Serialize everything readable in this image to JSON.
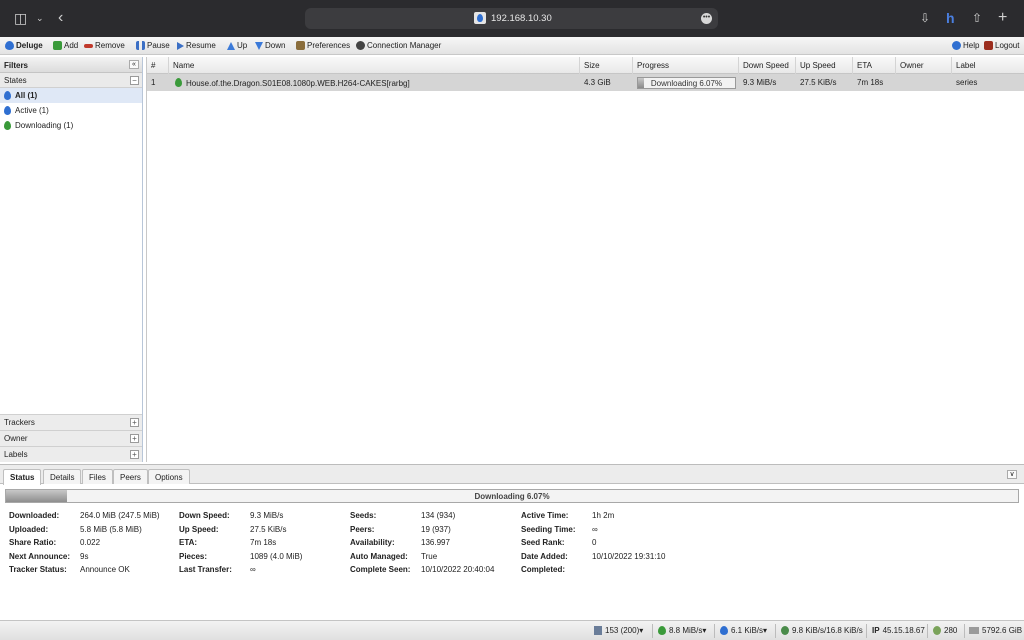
{
  "browser": {
    "address": "192.168.10.30",
    "icons": [
      "sidebar-icon",
      "chevron-down-icon",
      "back-icon",
      "more-icon",
      "download-icon",
      "extension-icon",
      "share-icon",
      "new-tab-icon"
    ]
  },
  "toolbar": {
    "app_name": "Deluge",
    "add": "Add",
    "remove": "Remove",
    "pause": "Pause",
    "resume": "Resume",
    "up": "Up",
    "down": "Down",
    "preferences": "Preferences",
    "connection_manager": "Connection Manager",
    "help": "Help",
    "logout": "Logout"
  },
  "sidebar": {
    "title": "Filters",
    "collapse_glyph": "«",
    "states_label": "States",
    "states": [
      {
        "label": "All (1)",
        "color": "#2f6fd1"
      },
      {
        "label": "Active (1)",
        "color": "#2f6fd1"
      },
      {
        "label": "Downloading (1)",
        "color": "#3a9a3a"
      }
    ],
    "sections": [
      "Trackers",
      "Owner",
      "Labels"
    ]
  },
  "grid": {
    "columns": [
      "#",
      "Name",
      "Size",
      "Progress",
      "Down Speed",
      "Up Speed",
      "ETA",
      "Owner",
      "Label"
    ],
    "rows": [
      {
        "num": "1",
        "name": "House.of.the.Dragon.S01E08.1080p.WEB.H264-CAKES[rarbg]",
        "size": "4.3 GiB",
        "progress_text": "Downloading 6.07%",
        "progress_pct": 6.07,
        "down_speed": "9.3 MiB/s",
        "up_speed": "27.5 KiB/s",
        "eta": "7m 18s",
        "owner": "",
        "label": "series"
      }
    ]
  },
  "details": {
    "tabs": [
      "Status",
      "Details",
      "Files",
      "Peers",
      "Options"
    ],
    "progress_text": "Downloading 6.07%",
    "progress_pct": 6.07,
    "col1": [
      {
        "label": "Downloaded:",
        "value": "264.0 MiB (247.5 MiB)"
      },
      {
        "label": "Uploaded:",
        "value": "5.8 MiB (5.8 MiB)"
      },
      {
        "label": "Share Ratio:",
        "value": "0.022"
      },
      {
        "label": "Next Announce:",
        "value": "9s"
      },
      {
        "label": "Tracker Status:",
        "value": "Announce OK"
      }
    ],
    "col2": [
      {
        "label": "Down Speed:",
        "value": "9.3 MiB/s"
      },
      {
        "label": "Up Speed:",
        "value": "27.5 KiB/s"
      },
      {
        "label": "ETA:",
        "value": "7m 18s"
      },
      {
        "label": "Pieces:",
        "value": "1089 (4.0 MiB)"
      },
      {
        "label": "Last Transfer:",
        "value": "∞"
      }
    ],
    "col3": [
      {
        "label": "Seeds:",
        "value": "134 (934)"
      },
      {
        "label": "Peers:",
        "value": "19 (937)"
      },
      {
        "label": "Availability:",
        "value": "136.997"
      },
      {
        "label": "Auto Managed:",
        "value": "True"
      },
      {
        "label": "Complete Seen:",
        "value": "10/10/2022 20:40:04"
      }
    ],
    "col4": [
      {
        "label": "Active Time:",
        "value": "1h 2m"
      },
      {
        "label": "Seeding Time:",
        "value": "∞"
      },
      {
        "label": "Seed Rank:",
        "value": "0"
      },
      {
        "label": "Date Added:",
        "value": "10/10/2022 19:31:10"
      },
      {
        "label": "Completed:",
        "value": ""
      }
    ]
  },
  "statusbar": {
    "connections": "153 (200)",
    "download": "8.8 MiB/s",
    "upload": "6.1 KiB/s",
    "protocol": "9.8 KiB/s/16.8 KiB/s",
    "ip_label": "IP",
    "ip": "45.15.18.67",
    "dht": "280",
    "free_space": "5792.6 GiB"
  }
}
